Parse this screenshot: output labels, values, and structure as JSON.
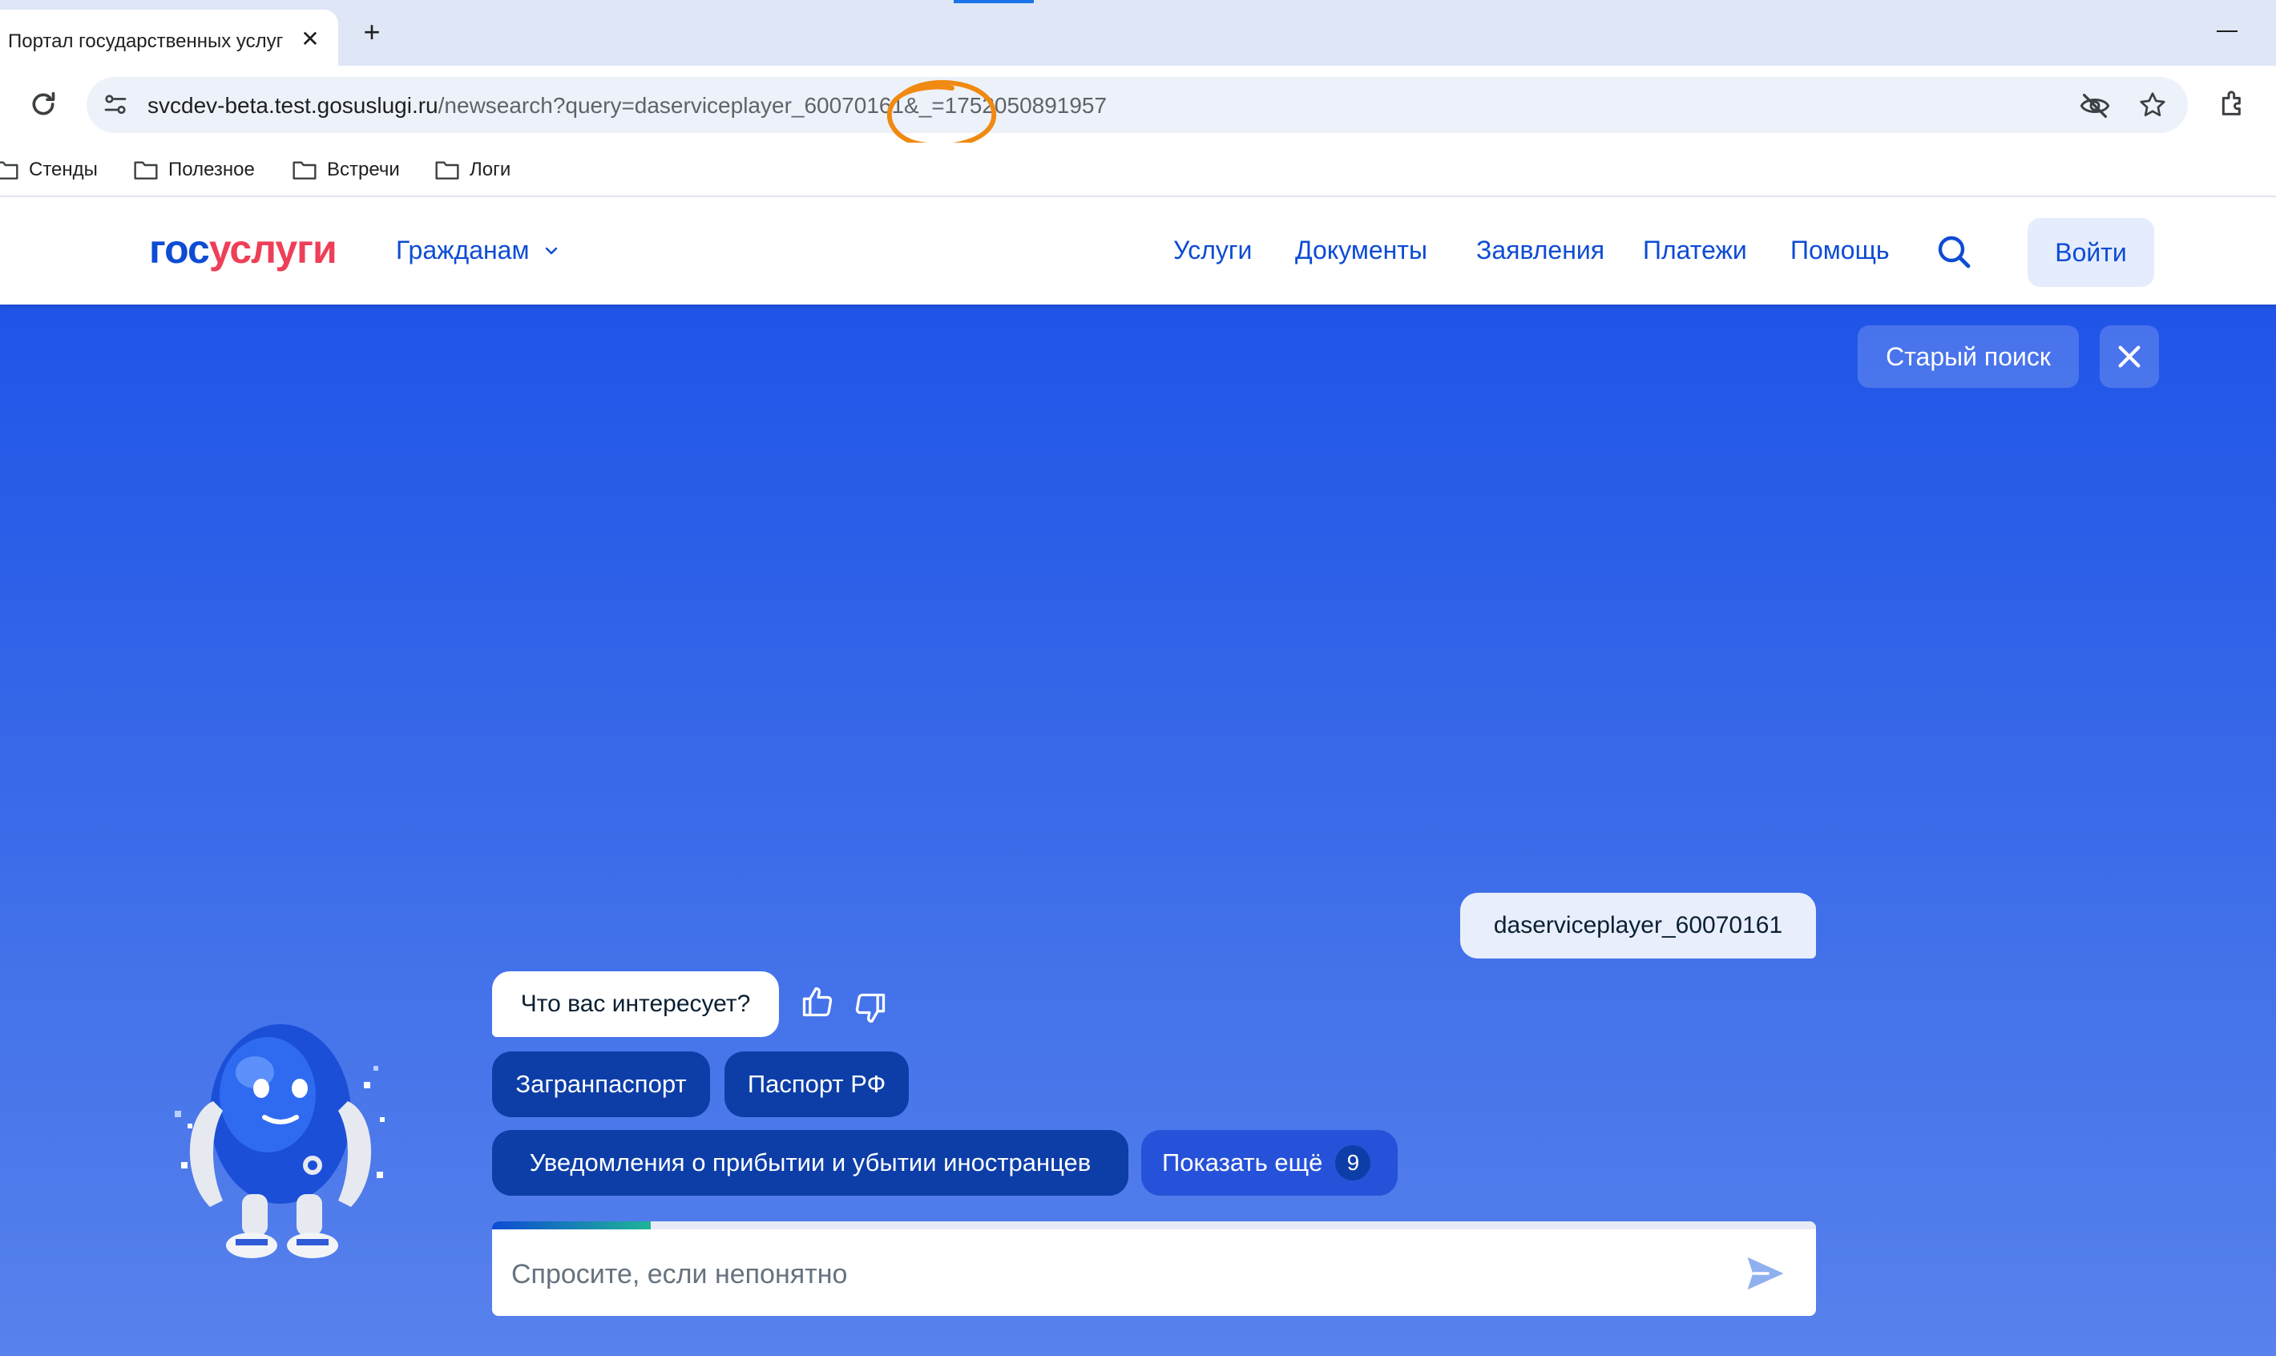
{
  "browser": {
    "tab_title": "Портал государственных услуг",
    "url_host": "svcdev-beta.test.gosuslugi.ru",
    "url_path": "/newsearch?query=daserviceplayer_60070161&_=1752050891957",
    "bookmarks": [
      "Стенды",
      "Полезное",
      "Встречи",
      "Логи"
    ]
  },
  "header": {
    "logo_part1": "гос",
    "logo_part2": "услуги",
    "audience": "Гражданам",
    "nav": [
      "Услуги",
      "Документы",
      "Заявления",
      "Платежи",
      "Помощь"
    ],
    "login": "Войти"
  },
  "main": {
    "old_search": "Старый поиск",
    "user_message": "daserviceplayer_60070161",
    "bot_message": "Что вас интересует?",
    "chips": [
      "Загранпаспорт",
      "Паспорт РФ",
      "Уведомления о прибытии и убытии иностранцев"
    ],
    "show_more": "Показать ещё",
    "show_more_count": "9",
    "input_placeholder": "Спросите, если непонятно",
    "input_progress": 0.12
  },
  "colors": {
    "brand_blue": "#0d4cd3",
    "brand_red": "#ee3f58",
    "chip_dark": "#0d3ea8",
    "annotation_orange": "#f08a12"
  },
  "icons": [
    "reload-icon",
    "site-info-icon",
    "eye-off-icon",
    "star-icon",
    "extensions-icon",
    "folder-icon",
    "chevron-down-icon",
    "search-icon",
    "close-icon",
    "thumb-up-icon",
    "thumb-down-icon",
    "send-icon"
  ]
}
